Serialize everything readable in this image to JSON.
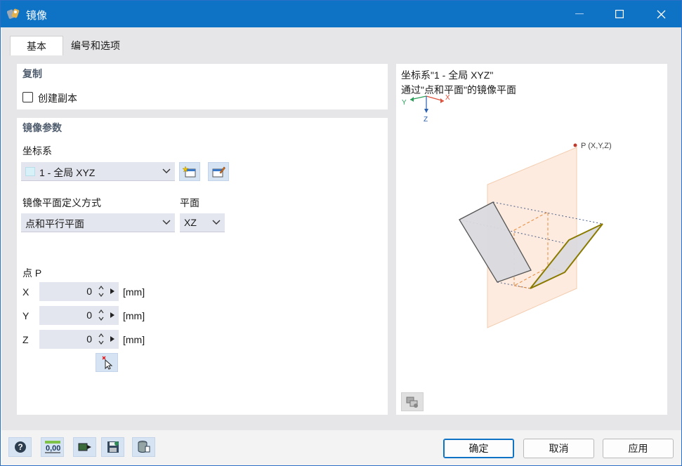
{
  "window": {
    "title": "镜像",
    "minimize_icon": "minimize-icon",
    "maximize_icon": "maximize-icon",
    "close_icon": "close-icon"
  },
  "tabs": [
    {
      "label": "基本",
      "active": true
    },
    {
      "label": "编号和选项",
      "active": false
    }
  ],
  "copy_section": {
    "title": "复制",
    "create_copy_label": "创建副本",
    "create_copy_checked": false
  },
  "mirror_params": {
    "title": "镜像参数",
    "coord_system_label": "坐标系",
    "coord_system_value": "1 - 全局 XYZ",
    "coord_swatch_color": "#d8f1f8",
    "definition_label": "镜像平面定义方式",
    "definition_value": "点和平行平面",
    "plane_label": "平面",
    "plane_value": "XZ",
    "point_label": "点 P",
    "coords": [
      {
        "axis": "X",
        "value": "0",
        "unit": "[mm]"
      },
      {
        "axis": "Y",
        "value": "0",
        "unit": "[mm]"
      },
      {
        "axis": "Z",
        "value": "0",
        "unit": "[mm]"
      }
    ]
  },
  "preview": {
    "line1": "坐标系\"1 - 全局 XYZ\"",
    "line2": "通过\"点和平面\"的镜像平面",
    "axis_x": "X",
    "axis_y": "Y",
    "axis_z": "Z",
    "point_label": "P (X,Y,Z)",
    "colors": {
      "plane_fill": "#fbe6d6",
      "original_fill": "#d9d9de",
      "mirror_stroke": "#8a7a00",
      "point": "#c0392b",
      "axis_x": "#e0503a",
      "axis_y": "#2aa05a",
      "axis_z": "#2a5fb0"
    }
  },
  "bottom": {
    "tools": [
      "help-icon",
      "units-icon",
      "export-icon",
      "save-icon",
      "database-icon"
    ],
    "units_text": "0,00",
    "ok_label": "确定",
    "cancel_label": "取消",
    "apply_label": "应用"
  }
}
